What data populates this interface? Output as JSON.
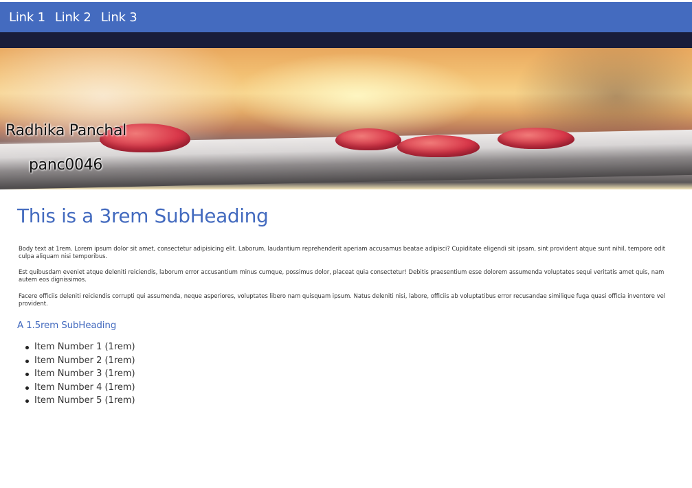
{
  "nav": {
    "links": [
      "Link 1",
      "Link 2",
      "Link 3"
    ]
  },
  "hero": {
    "title": "Radhika Panchal",
    "subtitle": "panc0046"
  },
  "main": {
    "heading": "This is a 3rem SubHeading",
    "paragraphs": [
      "Body text at 1rem. Lorem ipsum dolor sit amet, consectetur adipisicing elit. Laborum, laudantium reprehenderit aperiam accusamus beatae adipisci? Cupiditate eligendi sit ipsam, sint provident atque sunt nihil, tempore odit culpa aliquam nisi temporibus.",
      "Est quibusdam eveniet atque deleniti reiciendis, laborum error accusantium minus cumque, possimus dolor, placeat quia consectetur! Debitis praesentium esse dolorem assumenda voluptates sequi veritatis amet quis, nam autem eos dignissimos.",
      "Facere officiis deleniti reiciendis corrupti qui assumenda, neque asperiores, voluptates libero nam quisquam ipsum. Natus deleniti nisi, labore, officiis ab voluptatibus error recusandae similique fuga quasi officia inventore vel provident."
    ],
    "subheading": "A 1.5rem SubHeading",
    "list_items": [
      "Item Number 1 (1rem)",
      "Item Number 2 (1rem)",
      "Item Number 3 (1rem)",
      "Item Number 4 (1rem)",
      "Item Number 5 (1rem)"
    ]
  },
  "colors": {
    "nav_background": "#446bbf",
    "dark_bar": "#191d3a",
    "heading": "#446bbf",
    "body_text": "#333333"
  }
}
